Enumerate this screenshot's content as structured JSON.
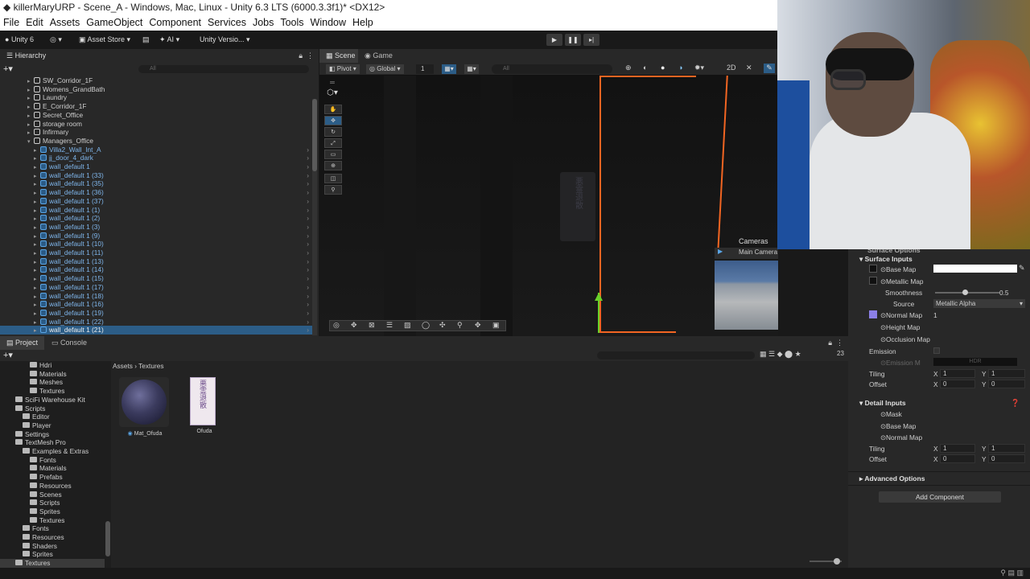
{
  "window": {
    "title": "killerMaryURP - Scene_A - Windows, Mac, Linux - Unity 6.3 LTS (6000.3.3f1)* <DX12>"
  },
  "menu": [
    "File",
    "Edit",
    "Assets",
    "GameObject",
    "Component",
    "Services",
    "Jobs",
    "Tools",
    "Window",
    "Help"
  ],
  "toolbar": {
    "unity_label": "Unity 6",
    "asset_store": "Asset Store",
    "ai": "AI",
    "version": "Unity Versio..."
  },
  "hierarchy": {
    "tab": "Hierarchy",
    "search_placeholder": "All",
    "items": [
      {
        "label": "SW_Corridor_1F",
        "indent": 1,
        "blue": false
      },
      {
        "label": "Womens_GrandBath",
        "indent": 1,
        "blue": false
      },
      {
        "label": "Laundry",
        "indent": 1,
        "blue": false
      },
      {
        "label": "E_Corridor_1F",
        "indent": 1,
        "blue": false
      },
      {
        "label": "Secret_Office",
        "indent": 1,
        "blue": false
      },
      {
        "label": "storage room",
        "indent": 1,
        "blue": false
      },
      {
        "label": "Infirmary",
        "indent": 1,
        "blue": false
      },
      {
        "label": "Managers_Office",
        "indent": 1,
        "blue": false
      },
      {
        "label": "Villa2_Wall_Int_A",
        "indent": 2,
        "blue": true
      },
      {
        "label": "jj_door_4_dark",
        "indent": 2,
        "blue": true
      },
      {
        "label": "wall_default 1",
        "indent": 2,
        "blue": true
      },
      {
        "label": "wall_default 1 (33)",
        "indent": 2,
        "blue": true
      },
      {
        "label": "wall_default 1 (35)",
        "indent": 2,
        "blue": true
      },
      {
        "label": "wall_default 1 (36)",
        "indent": 2,
        "blue": true
      },
      {
        "label": "wall_default 1 (37)",
        "indent": 2,
        "blue": true
      },
      {
        "label": "wall_default 1 (1)",
        "indent": 2,
        "blue": true
      },
      {
        "label": "wall_default 1 (2)",
        "indent": 2,
        "blue": true
      },
      {
        "label": "wall_default 1 (3)",
        "indent": 2,
        "blue": true
      },
      {
        "label": "wall_default 1 (9)",
        "indent": 2,
        "blue": true
      },
      {
        "label": "wall_default 1 (10)",
        "indent": 2,
        "blue": true
      },
      {
        "label": "wall_default 1 (11)",
        "indent": 2,
        "blue": true
      },
      {
        "label": "wall_default 1 (13)",
        "indent": 2,
        "blue": true
      },
      {
        "label": "wall_default 1 (14)",
        "indent": 2,
        "blue": true
      },
      {
        "label": "wall_default 1 (15)",
        "indent": 2,
        "blue": true
      },
      {
        "label": "wall_default 1 (17)",
        "indent": 2,
        "blue": true
      },
      {
        "label": "wall_default 1 (18)",
        "indent": 2,
        "blue": true
      },
      {
        "label": "wall_default 1 (16)",
        "indent": 2,
        "blue": true
      },
      {
        "label": "wall_default 1 (19)",
        "indent": 2,
        "blue": true
      },
      {
        "label": "wall_default 1 (22)",
        "indent": 2,
        "blue": true
      },
      {
        "label": "wall_default 1 (21)",
        "indent": 2,
        "blue": true,
        "selected": true
      }
    ]
  },
  "scene": {
    "tab_scene": "Scene",
    "tab_game": "Game",
    "pivot": "Pivot",
    "global": "Global",
    "grid_value": "1",
    "search_placeholder": "All",
    "cameras_title": "Cameras",
    "main_camera": "Main Camera",
    "ofuda_text": "悪霊退散"
  },
  "project": {
    "tab_project": "Project",
    "tab_console": "Console",
    "breadcrumb": [
      "Assets",
      "Textures"
    ],
    "count": "23",
    "tree": [
      {
        "label": "Hdri",
        "indent": 3
      },
      {
        "label": "Materials",
        "indent": 3
      },
      {
        "label": "Meshes",
        "indent": 3
      },
      {
        "label": "Textures",
        "indent": 3
      },
      {
        "label": "SciFi Warehouse Kit",
        "indent": 1
      },
      {
        "label": "Scripts",
        "indent": 1
      },
      {
        "label": "Editor",
        "indent": 2
      },
      {
        "label": "Player",
        "indent": 2
      },
      {
        "label": "Settings",
        "indent": 1
      },
      {
        "label": "TextMesh Pro",
        "indent": 1
      },
      {
        "label": "Examples & Extras",
        "indent": 2
      },
      {
        "label": "Fonts",
        "indent": 3
      },
      {
        "label": "Materials",
        "indent": 3
      },
      {
        "label": "Prefabs",
        "indent": 3
      },
      {
        "label": "Resources",
        "indent": 3
      },
      {
        "label": "Scenes",
        "indent": 3
      },
      {
        "label": "Scripts",
        "indent": 3
      },
      {
        "label": "Sprites",
        "indent": 3
      },
      {
        "label": "Textures",
        "indent": 3
      },
      {
        "label": "Fonts",
        "indent": 2
      },
      {
        "label": "Resources",
        "indent": 2
      },
      {
        "label": "Shaders",
        "indent": 2
      },
      {
        "label": "Sprites",
        "indent": 2
      },
      {
        "label": "Textures",
        "indent": 1,
        "selected": true
      }
    ],
    "assets": [
      {
        "label": "Mat_Ofuda"
      },
      {
        "label": "Ofuda"
      }
    ]
  },
  "inspector": {
    "surface_options": "Surface Options",
    "surface_inputs": "Surface Inputs",
    "base_map": "Base Map",
    "metallic_map": "Metallic Map",
    "smoothness": "Smoothness",
    "smoothness_value": "0.5",
    "source": "Source",
    "source_value": "Metallic Alpha",
    "normal_map": "Normal Map",
    "normal_value": "1",
    "height_map": "Height Map",
    "occlusion_map": "Occlusion Map",
    "emission": "Emission",
    "emission_map": "Emission M",
    "hdr": "HDR",
    "tiling": "Tiling",
    "offset": "Offset",
    "x": "X",
    "y": "Y",
    "tiling_x": "1",
    "tiling_y": "1",
    "offset_x": "0",
    "offset_y": "0",
    "detail_inputs": "Detail Inputs",
    "mask": "Mask",
    "detail_base_map": "Base Map",
    "detail_normal_map": "Normal Map",
    "detail_tiling_x": "1",
    "detail_tiling_y": "1",
    "detail_offset_x": "0",
    "detail_offset_y": "0",
    "advanced_options": "Advanced Options",
    "add_component": "Add Component"
  },
  "colors": {
    "accent_blue": "#2c5d87",
    "selection_orange": "#f26522",
    "normal_map_swatch": "#8b7fe6"
  }
}
